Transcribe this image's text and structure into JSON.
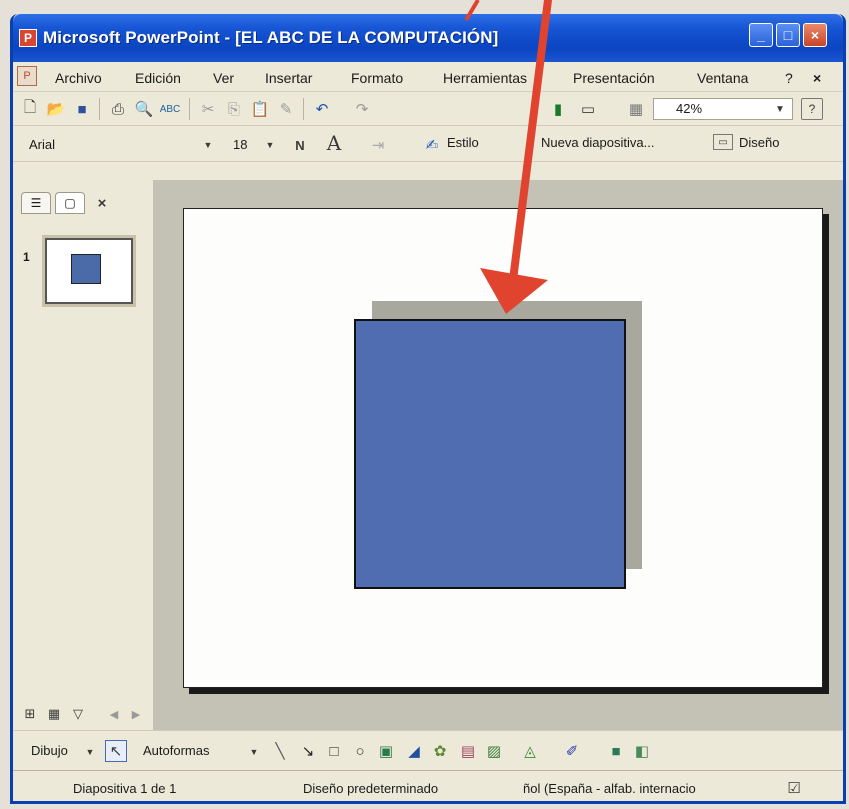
{
  "window": {
    "title": "Microsoft PowerPoint - [EL ABC DE LA COMPUTACIÓN]"
  },
  "menu": {
    "items": [
      "Archivo",
      "Edición",
      "Ver",
      "Insertar",
      "Formato",
      "Herramientas",
      "Presentación",
      "Ventana",
      "?"
    ]
  },
  "toolbar": {
    "zoom": "42%",
    "font": "Arial",
    "size": "18",
    "bold_label": "N",
    "style_label": "Estilo",
    "new_slide_label": "Nueva diapositiva...",
    "design_label": "Diseño"
  },
  "slides_pane": {
    "slide_number": "1"
  },
  "drawing": {
    "draw_label": "Dibujo",
    "autoshapes_label": "Autoformas"
  },
  "status": {
    "slide": "Diapositiva 1 de 1",
    "design": "Diseño predeterminado",
    "language": "ñol (España - alfab. internacio"
  },
  "colors": {
    "shape_fill": "#4f6db0",
    "annotation_arrow": "#e0432e"
  }
}
